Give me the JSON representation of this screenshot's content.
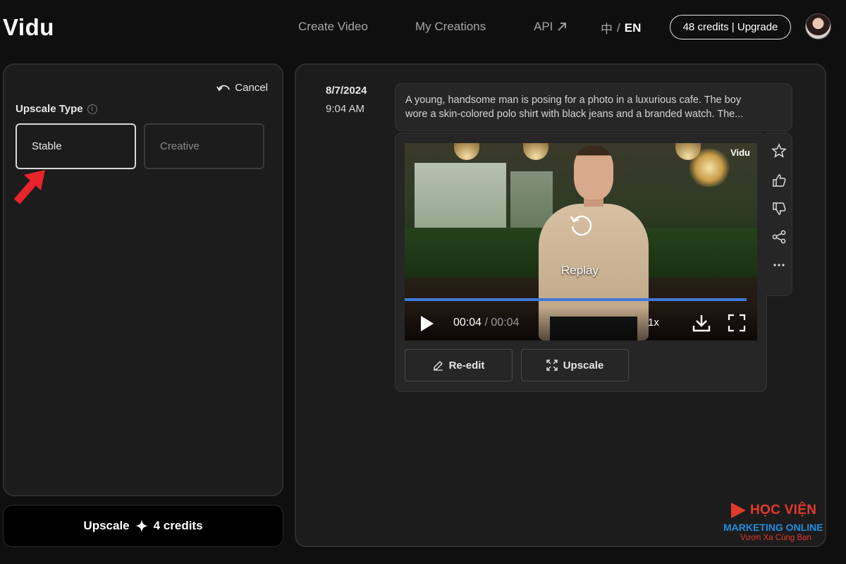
{
  "app": {
    "title": "Vidu"
  },
  "nav": {
    "create_video": "Create Video",
    "my_creations": "My Creations",
    "api": "API",
    "lang_zh": "中",
    "lang_sep": "/",
    "lang_en": "EN",
    "credits_upgrade": "48 credits | Upgrade"
  },
  "upscale_panel": {
    "cancel": "Cancel",
    "upscale_type_label": "Upscale Type",
    "info_glyph": "i",
    "options": [
      {
        "label": "Stable",
        "selected": true
      },
      {
        "label": "Creative",
        "selected": false
      }
    ],
    "submit_label": "Upscale",
    "submit_icon": "sparkle-icon",
    "submit_credits": "4 credits"
  },
  "creation": {
    "date": "8/7/2024",
    "time": "9:04 AM",
    "prompt_line1": "A young, handsome man is posing for a photo in a luxurious cafe. The boy",
    "prompt_line2": "wore a skin-colored polo shirt with black jeans and a branded watch. The...",
    "video": {
      "watermark": "Vidu",
      "replay_label": "Replay",
      "current_time": "00:04",
      "time_sep": " / ",
      "duration": "00:04",
      "speed": "1x",
      "progress_fraction": 0.97
    },
    "actions": [
      "star-icon",
      "thumbs-up-icon",
      "thumbs-down-icon",
      "share-icon",
      "more-icon"
    ],
    "buttons": {
      "reedit": "Re-edit",
      "upscale": "Upscale"
    }
  },
  "brand_watermark": {
    "name": "HỌC VIỆN",
    "subtitle": "MARKETING ONLINE",
    "tagline": "Vươn Xa Cùng Bạn"
  },
  "colors": {
    "background": "#0f0f0f",
    "panel": "#1c1c1c",
    "progress": "#3f78d9",
    "annotation_arrow": "#e8232a",
    "brand_red": "#e23a2c",
    "brand_blue": "#1f8fe0"
  }
}
